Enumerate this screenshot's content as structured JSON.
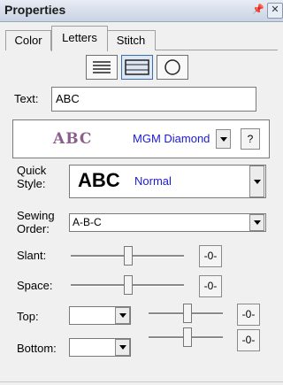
{
  "window": {
    "title": "Properties"
  },
  "tabs": [
    "Color",
    "Letters",
    "Stitch"
  ],
  "text_field": {
    "label": "Text:",
    "value": "ABC"
  },
  "font": {
    "preview": "ABC",
    "name": "MGM Diamond",
    "help": "?"
  },
  "quick_style": {
    "label_line1": "Quick",
    "label_line2": "Style:",
    "sample": "ABC",
    "value": "Normal"
  },
  "sewing_order": {
    "label_line1": "Sewing",
    "label_line2": "Order:",
    "value": "A-B-C"
  },
  "slant": {
    "label": "Slant:",
    "reset": "-0-"
  },
  "space": {
    "label": "Space:",
    "reset": "-0-"
  },
  "top": {
    "label": "Top:",
    "value": "",
    "reset": "-0-"
  },
  "bottom": {
    "label": "Bottom:",
    "value": "",
    "reset": "-0-"
  },
  "colors": {
    "accent": "#1a1ad6",
    "monogram": "#8a5f8c"
  }
}
